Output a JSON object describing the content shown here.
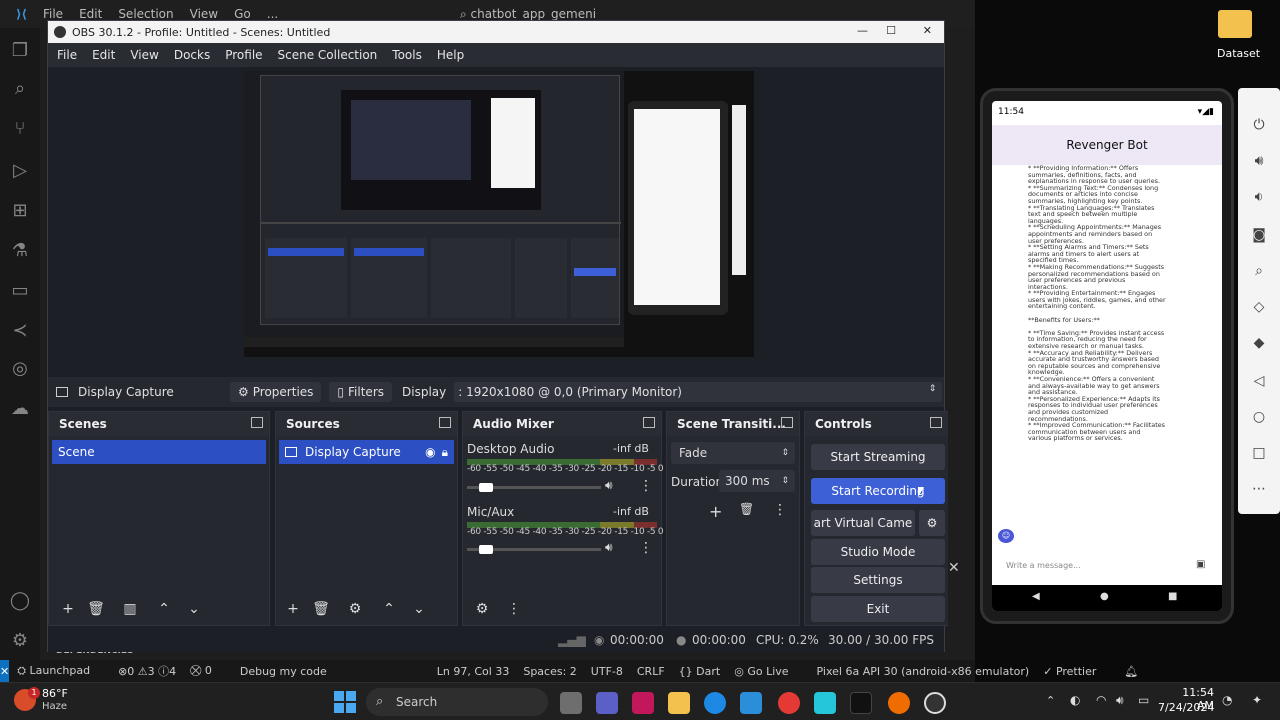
{
  "vscode": {
    "menu": [
      "File",
      "Edit",
      "Selection",
      "View",
      "Go",
      "..."
    ],
    "search": "chatbot_app_gemeni",
    "outline_label": "DEPENDENCIES",
    "status": {
      "launchpad": "Launchpad",
      "problems": "⊗0 ⚠3 ⓘ4",
      "ports": "0",
      "debug": "Debug my code",
      "position": "Ln 97, Col 33",
      "spaces": "Spaces: 2",
      "encoding": "UTF-8",
      "eol": "CRLF",
      "language": "{} Dart",
      "golive": "Go Live",
      "device": "Pixel 6a API 30 (android-x86 emulator)",
      "prettier": "Prettier"
    }
  },
  "obs": {
    "title": "OBS 30.1.2 - Profile: Untitled - Scenes: Untitled",
    "menu": [
      "File",
      "Edit",
      "View",
      "Docks",
      "Profile",
      "Scene Collection",
      "Tools",
      "Help"
    ],
    "source_bar": {
      "name": "Display Capture",
      "properties": "Properties",
      "filters": "Filters",
      "display_label": "Display",
      "display_value": ": 1920x1080 @ 0,0 (Primary Monitor)"
    },
    "scenes": {
      "title": "Scenes",
      "items": [
        "Scene"
      ]
    },
    "sources": {
      "title": "Sources",
      "items": [
        "Display Capture"
      ]
    },
    "mixer": {
      "title": "Audio Mixer",
      "ticks": "-60 -55 -50 -45 -40 -35 -30 -25 -20 -15 -10 -5 0",
      "channels": [
        {
          "name": "Desktop Audio",
          "level": "-inf dB",
          "volume": 0.1
        },
        {
          "name": "Mic/Aux",
          "level": "-inf dB",
          "volume": 0.1
        }
      ]
    },
    "transitions": {
      "title": "Scene Transiti...",
      "type": "Fade",
      "duration_label": "Duration",
      "duration": "300 ms"
    },
    "controls": {
      "title": "Controls",
      "start_streaming": "Start Streaming",
      "start_recording": "Start Recording",
      "virtual_camera": "art Virtual Came",
      "studio_mode": "Studio Mode",
      "settings": "Settings",
      "exit": "Exit"
    },
    "status": {
      "stream_time": "00:00:00",
      "rec_time": "00:00:00",
      "cpu": "CPU: 0.2%",
      "fps": "30.00 / 30.00 FPS"
    }
  },
  "desktop": {
    "folder_label": "Dataset"
  },
  "phone": {
    "time": "11:54",
    "app_title": "Revenger Bot",
    "lines": [
      "* **Providing Information:** Offers",
      "summaries, definitions, facts, and",
      "explanations in response to user queries.",
      "* **Summarizing Text:** Condenses long",
      "documents or articles into concise",
      "summaries, highlighting key points.",
      "* **Translating Languages:** Translates",
      "text and speech between multiple",
      "languages.",
      "* **Scheduling Appointments:** Manages",
      "appointments and reminders based on",
      "user preferences.",
      "* **Setting Alarms and Timers:** Sets",
      "alarms and timers to alert users at",
      "specified times.",
      "* **Making Recommendations:** Suggests",
      "personalized recommendations based on",
      "user preferences and previous",
      "interactions.",
      "* **Providing Entertainment:** Engages",
      "users with jokes, riddles, games, and other",
      "entertaining content.",
      "",
      "**Benefits for Users:**",
      "",
      "* **Time Saving:** Provides instant access",
      "to information, reducing the need for",
      "extensive research or manual tasks.",
      "* **Accuracy and Reliability:** Delivers",
      "accurate and trustworthy answers based",
      "on reputable sources and comprehensive",
      "knowledge.",
      "* **Convenience:** Offers a convenient",
      "and always-available way to get answers",
      "and assistance.",
      "* **Personalized Experience:** Adapts its",
      "responses to individual user preferences",
      "and provides customized",
      "recommendations.",
      "* **Improved Communication:** Facilitates",
      "communication between users and",
      "various platforms or services."
    ],
    "input_placeholder": "Write a message..."
  },
  "taskbar": {
    "weather_temp": "86°F",
    "weather_desc": "Haze",
    "weather_badge": "1",
    "search_placeholder": "Search",
    "time": "11:54 AM",
    "date": "7/24/2024"
  }
}
